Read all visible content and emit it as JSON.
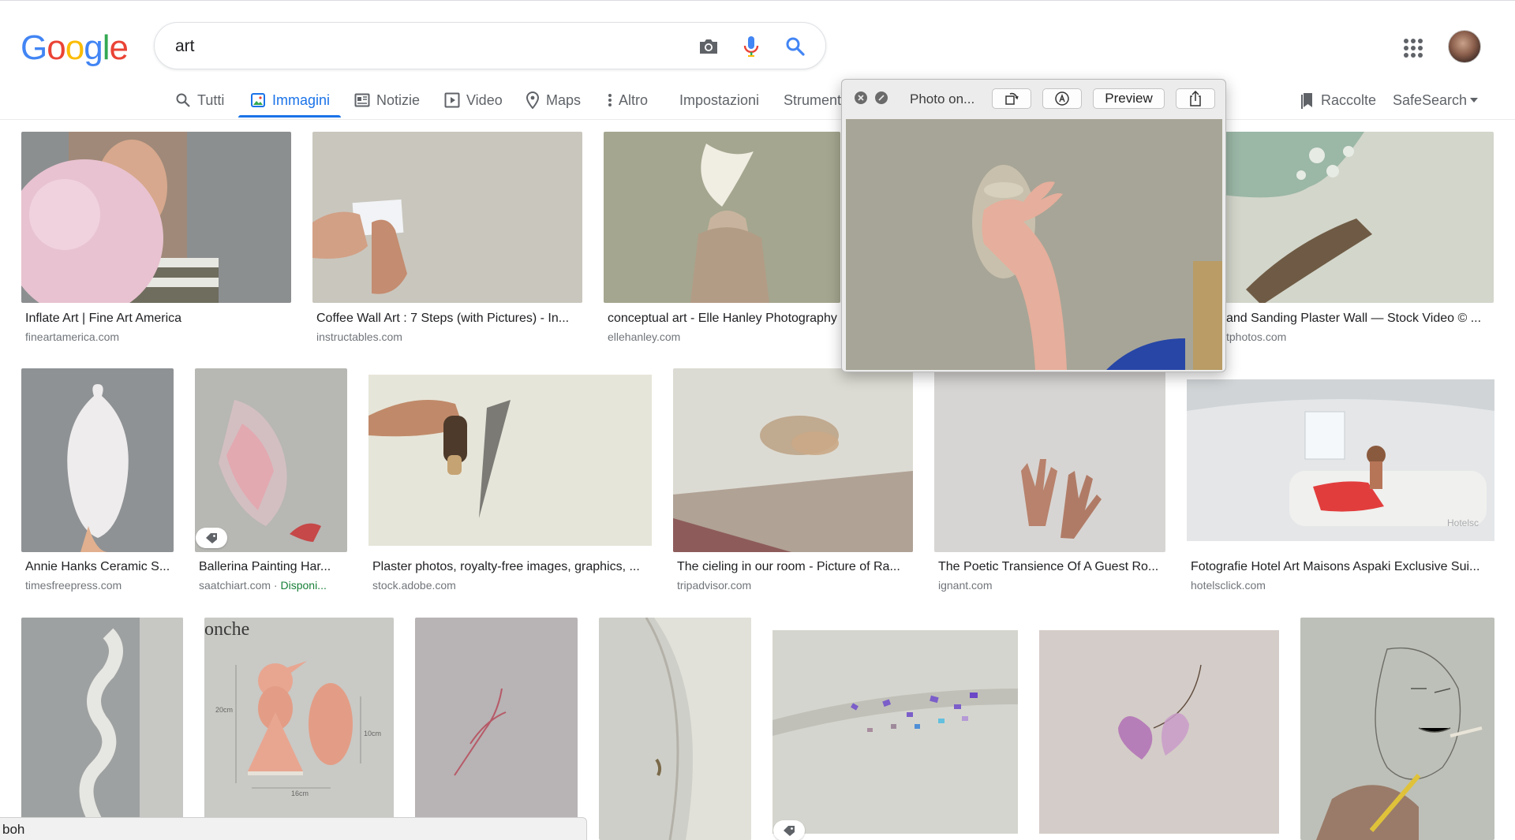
{
  "search": {
    "query": "art"
  },
  "logo": {
    "letters": [
      "G",
      "o",
      "o",
      "g",
      "l",
      "e"
    ],
    "colors": [
      "#4285F4",
      "#EA4335",
      "#FBBC05",
      "#4285F4",
      "#34A853",
      "#EA4335"
    ]
  },
  "tabs": [
    {
      "label": "Tutti",
      "icon": "search-icon"
    },
    {
      "label": "Immagini",
      "icon": "image-icon"
    },
    {
      "label": "Notizie",
      "icon": "news-icon"
    },
    {
      "label": "Video",
      "icon": "play-icon"
    },
    {
      "label": "Maps",
      "icon": "map-pin-icon"
    },
    {
      "label": "Altro",
      "icon": "more-vertical-icon"
    },
    {
      "label": "Impostazioni"
    },
    {
      "label": "Strumenti"
    }
  ],
  "right_nav": {
    "collections": "Raccolte",
    "safesearch": "SafeSearch"
  },
  "popup": {
    "title": "Photo on...",
    "preview_label": "Preview"
  },
  "results": [
    {
      "title": "Inflate Art | Fine Art America",
      "source": "fineartamerica.com"
    },
    {
      "title": "Coffee Wall Art : 7 Steps (with Pictures) - In...",
      "source": "instructables.com"
    },
    {
      "title": "conceptual art - Elle Hanley Photography",
      "source": "ellehanley.com"
    },
    {
      "title": "",
      "source": ""
    },
    {
      "title": "and Sanding Plaster Wall — Stock Video © ...",
      "source": "tphotos.com"
    },
    {
      "title": "Annie Hanks Ceramic S...",
      "source": "timesfreepress.com"
    },
    {
      "title": "Ballerina Painting Har...",
      "source": "saatchiart.com · ",
      "extra": "Disponi..."
    },
    {
      "title": "Plaster photos, royalty-free images, graphics, ...",
      "source": "stock.adobe.com"
    },
    {
      "title": "The cieling in our room - Picture of Ra...",
      "source": "tripadvisor.com"
    },
    {
      "title": "The Poetic Transience Of A Guest Ro...",
      "source": "ignant.com"
    },
    {
      "title": "Fotografie Hotel Art Maisons Aspaki Exclusive Sui...",
      "source": "hotelsclick.com"
    }
  ],
  "thumb_text": {
    "onche": "onche",
    "dim_20": "20cm",
    "dim_10": "10cm",
    "dim_16": "16cm",
    "hotels_wm": "Hotelsc"
  },
  "status": {
    "text": "boh"
  },
  "colors": {
    "accent": "#1a73e8",
    "available": "#188038"
  }
}
